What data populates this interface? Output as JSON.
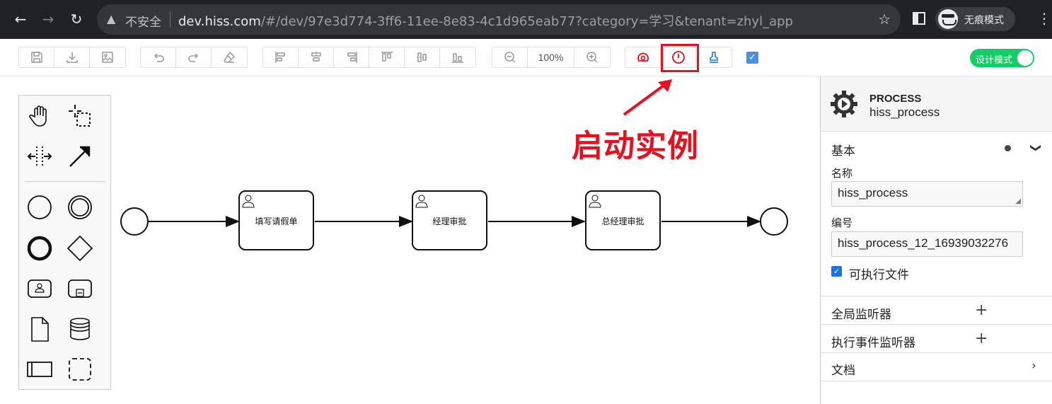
{
  "browser": {
    "security_label": "不安全",
    "url_host": "dev.hiss.com",
    "url_path": "/#/dev/97e3d774-3ff6-11ee-8e83-4c1d965eab77?category=学习&tenant=zhyl_app",
    "incognito_label": "无痕模式"
  },
  "toolbar": {
    "zoom_level": "100%",
    "design_mode_label": "设计模式",
    "design_mode_on": true,
    "icons": [
      "save-icon",
      "download-icon",
      "image-icon",
      "undo-icon",
      "redo-icon",
      "eraser-icon",
      "align-left-icon",
      "align-center-icon",
      "align-right-icon",
      "align-top-icon",
      "align-middle-icon",
      "align-bottom-icon",
      "zoom-out-icon",
      "zoom-in-icon",
      "simulate-icon",
      "start-instance-icon",
      "stamp-icon"
    ],
    "accent_red": "#e8101d"
  },
  "annotation": {
    "text": "启动实例"
  },
  "diagram": {
    "tasks": [
      {
        "label": "填写请假单"
      },
      {
        "label": "经理审批"
      },
      {
        "label": "总经理审批"
      }
    ]
  },
  "panel": {
    "type": "PROCESS",
    "name": "hiss_process",
    "basic_section": "基本",
    "name_label": "名称",
    "name_value": "hiss_process",
    "id_label": "编号",
    "id_value": "hiss_process_12_16939032276",
    "executable_label": "可执行文件",
    "global_listeners": "全局监听器",
    "exec_listeners": "执行事件监听器",
    "docs": "文档"
  }
}
